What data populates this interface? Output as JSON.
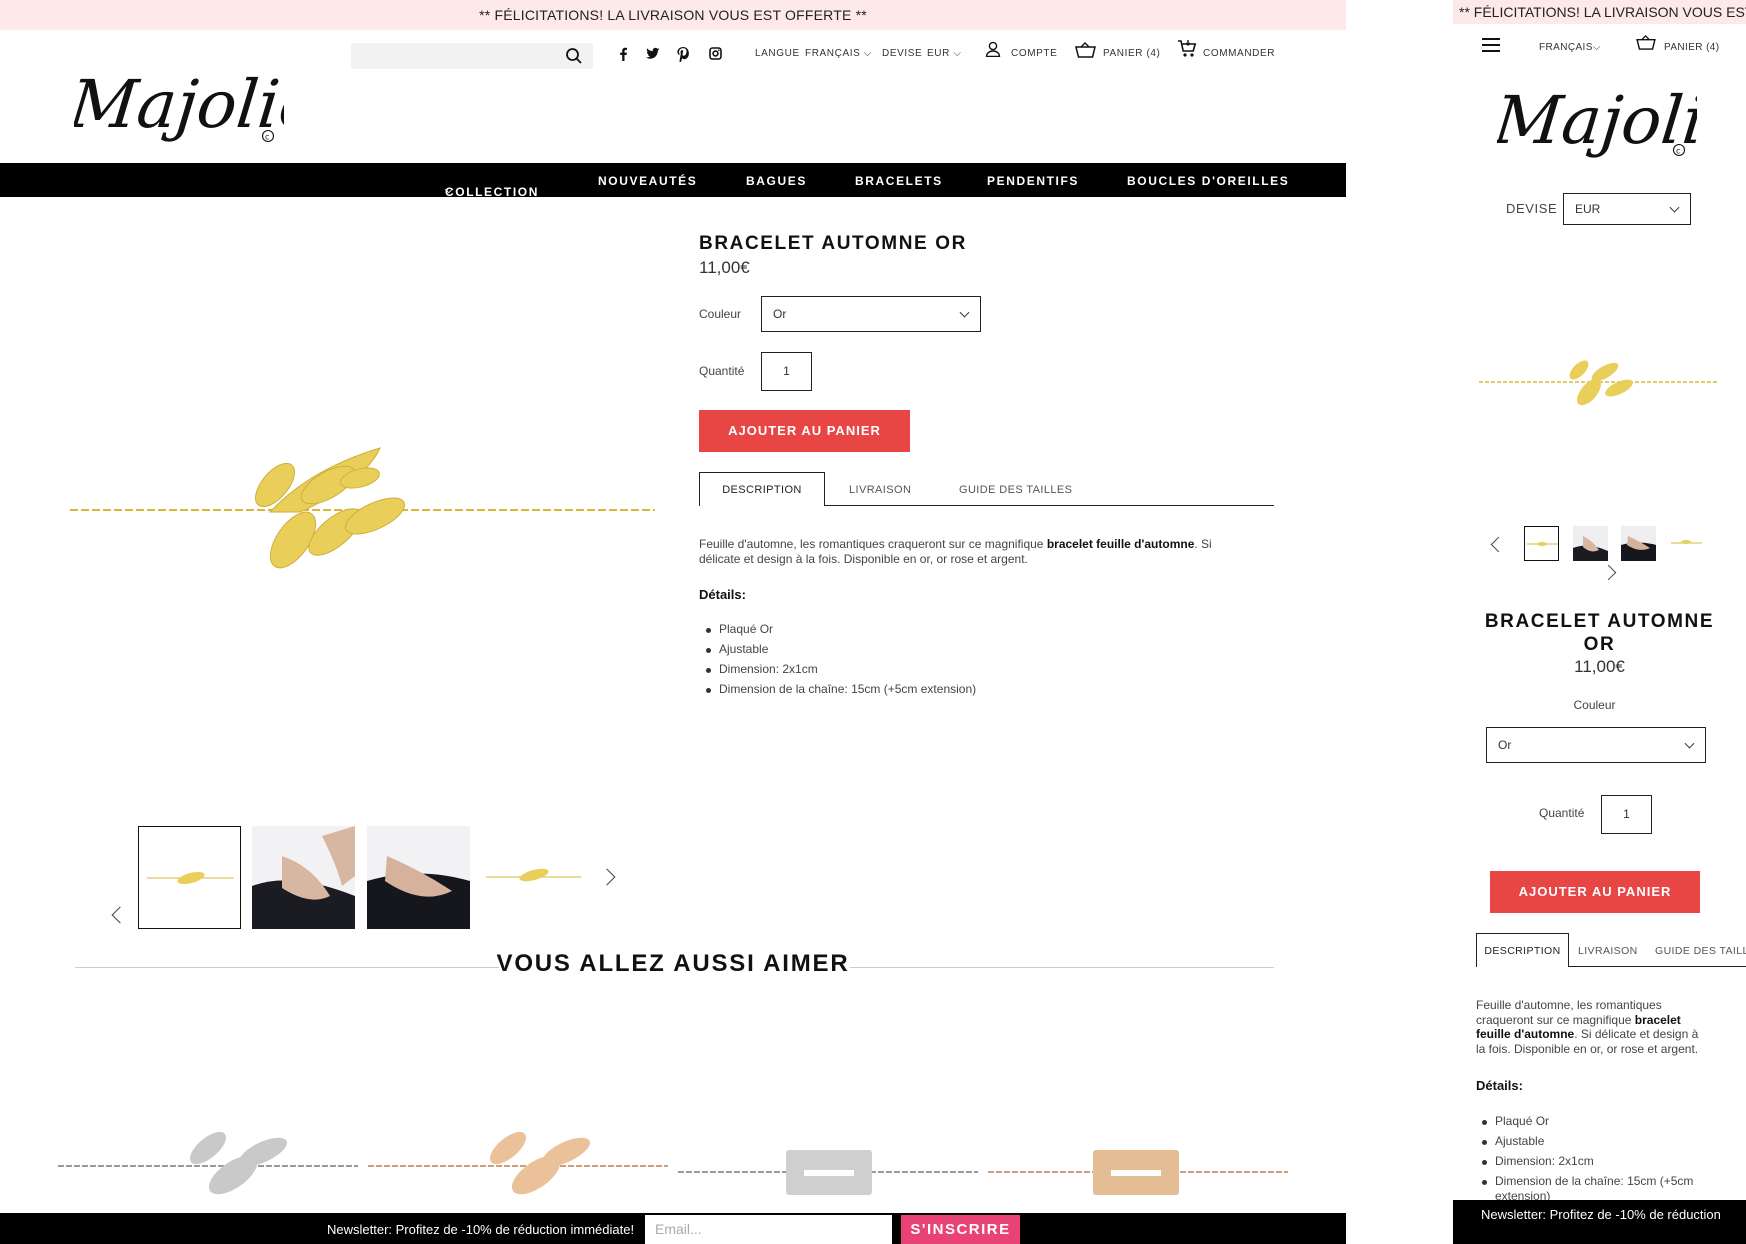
{
  "promo_banner": "** FÉLICITATIONS! LA LIVRAISON VOUS EST OFFERTE **",
  "promo_banner_mobile": "** FÉLICITATIONS! LA LIVRAISON VOUS EST",
  "header": {
    "search_placeholder": "",
    "language_label": "LANGUE",
    "language_value": "FRANÇAIS",
    "currency_label": "DEVISE",
    "currency_value": "EUR",
    "account_label": "COMPTE",
    "cart_label": "PANIER (4)",
    "checkout_label": "COMMANDER",
    "social_icons": [
      "facebook-icon",
      "twitter-icon",
      "pinterest-icon",
      "instagram-icon"
    ]
  },
  "logo_text": "Majolie",
  "nav": {
    "items": [
      "COLLECTION",
      "NOUVEAUTÉS",
      "BAGUES",
      "BRACELETS",
      "PENDENTIFS",
      "BOUCLES D'OREILLES"
    ]
  },
  "product": {
    "title": "BRACELET AUTOMNE OR",
    "title_mobile_line1": "BRACELET AUTOMNE",
    "title_mobile_line2": "OR",
    "price": "11,00€",
    "color_label": "Couleur",
    "color_value": "Or",
    "quantity_label": "Quantité",
    "quantity_value": "1",
    "add_to_cart": "AJOUTER AU PANIER",
    "tabs": [
      "DESCRIPTION",
      "LIVRAISON",
      "GUIDE DES TAILLES"
    ],
    "description_pre": "Feuille d'automne, les romantiques craqueront sur ce magnifique ",
    "description_bold": "bracelet feuille d'automne",
    "description_post": ". Si délicate et design à la fois. Disponible en or, or rose et argent.",
    "details_heading": "Détails:",
    "details": [
      "Plaqué Or",
      "Ajustable",
      "Dimension: 2x1cm",
      "Dimension de la chaîne: 15cm (+5cm extension)"
    ]
  },
  "mobile": {
    "currency_label": "DEVISE",
    "currency_value": "EUR",
    "language_value": "FRANÇAIS",
    "cart_label": "PANIER (4)",
    "desc_line1": "Feuille d'automne, les romantiques",
    "desc_line2_pre": "craqueront sur ce magnifique ",
    "desc_line2_bold": "bracelet",
    "desc_line3_bold": "feuille d'automne",
    "desc_line3_post": ". Si délicate et design à",
    "desc_line4": "la fois. Disponible en or, or rose et argent.",
    "detail_4_line1": "Dimension de la chaîne: 15cm (+5cm",
    "detail_4_line2": "extension)"
  },
  "related_heading": "VOUS ALLEZ AUSSI AIMER",
  "newsletter": {
    "text": "Newsletter: Profitez de -10% de réduction immédiate!",
    "text_mobile": "Newsletter: Profitez de -10% de réduction",
    "email_placeholder": "Email...",
    "subscribe": "S'INSCRIRE"
  },
  "colors": {
    "accent_red": "#e84545",
    "newsletter_pink": "#e94277",
    "promo_bg": "#fde9e7",
    "gold": "#e6c84a"
  }
}
